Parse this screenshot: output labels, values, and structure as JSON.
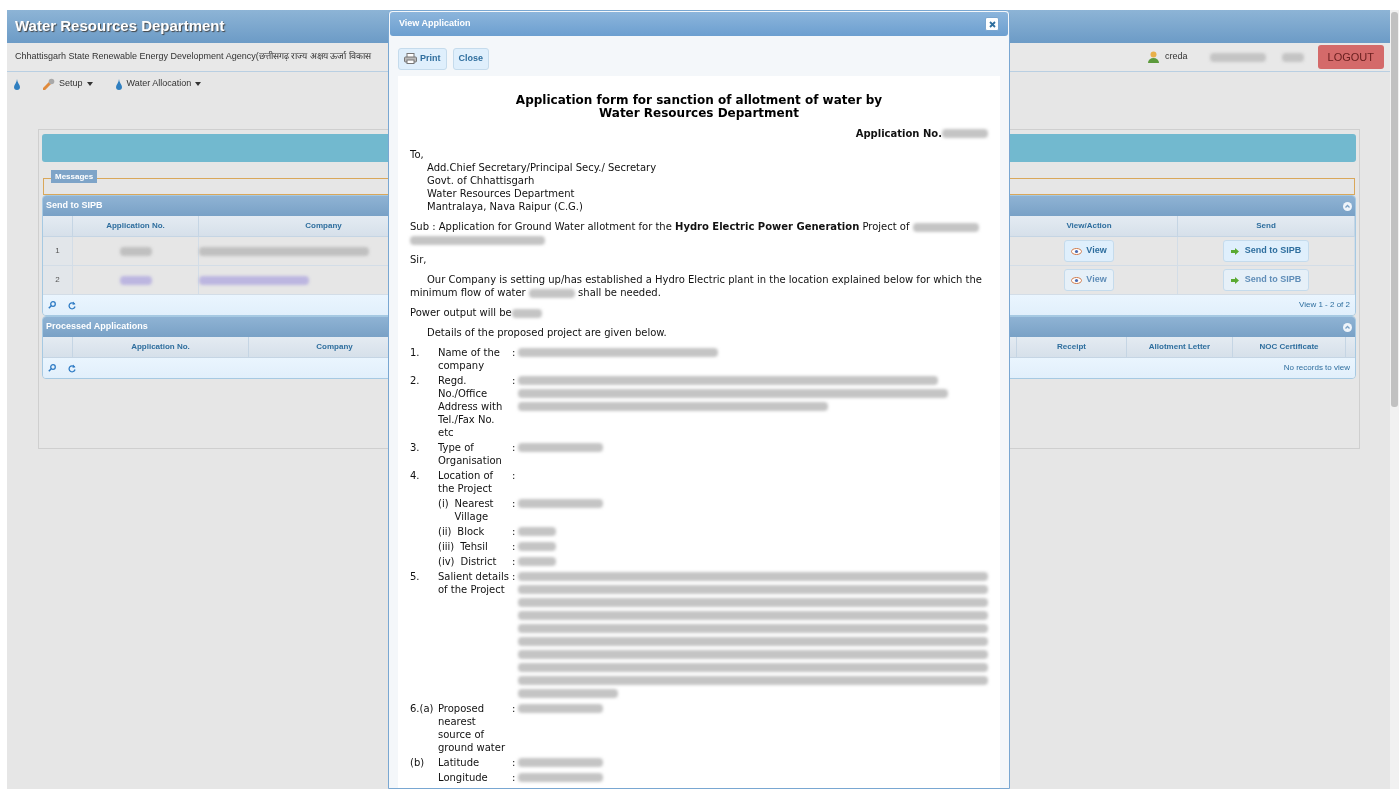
{
  "header": {
    "title": "Water Resources Department",
    "agency": "Chhattisgarh State Renewable Energy Development Agency(छत्तीसगढ़ राज्य अक्षय ऊर्जा विकास",
    "user": "creda",
    "logout": "LOGOUT"
  },
  "menu": [
    {
      "kind": "icon"
    },
    {
      "kind": "menu",
      "label": "Setup"
    },
    {
      "kind": "menu",
      "label": "Water Allocation"
    }
  ],
  "messages": {
    "legend": "Messages"
  },
  "send_grid": {
    "caption": "Send to SIPB",
    "columns": [
      "Application No.",
      "Company",
      "View/Action",
      "Send"
    ],
    "rows": [
      {
        "number": "1",
        "linked": false,
        "disabled": false,
        "view": "View",
        "send": "Send to SIPB"
      },
      {
        "number": "2",
        "linked": true,
        "disabled": true,
        "view": "View",
        "send": "Send to SIPB"
      }
    ],
    "footer": "View 1 - 2 of 2"
  },
  "processed_grid": {
    "caption": "Processed Applications",
    "columns": [
      "Application No.",
      "Company",
      "Receipt",
      "Allotment Letter",
      "NOC Certificate"
    ],
    "footer": "No records to view"
  },
  "dialog": {
    "title": "View Application",
    "buttons": [
      {
        "label": "Print"
      },
      {
        "label": "Close"
      }
    ],
    "form": {
      "title": [
        "Application form for sanction of allotment of water by",
        "Water Resources Department"
      ],
      "application_no": "Application No.",
      "to": "To,",
      "address": [
        "Add.Chief Secretary/Principal Secy./ Secretary",
        "Govt. of Chhattisgarh",
        "Water Resources Department",
        "Mantralaya, Nava Raipur (C.G.)"
      ],
      "subject": "Sub : Application for Ground Water allotment for the **Hydro Electric Power Generation** Project of",
      "salutation": "Sir,",
      "body": "Our Company is setting up/has established a Hydro Electric plant in the location explained below for which the minimum flow of water",
      "body_end": "shall be needed.",
      "power": "Power output will be",
      "intro": "Details of the proposed project are given below.",
      "items": [
        {
          "number": "1.",
          "label": "Name of the company",
          "colon": ":",
          "kind": "line"
        },
        {
          "number": "2.",
          "label": "Regd. No./Office Address with Tel./Fax No. etc",
          "colon": ":",
          "kind": "block"
        },
        {
          "number": "3.",
          "label": "Type of Organisation",
          "colon": ":",
          "kind": "short"
        },
        {
          "number": "4.",
          "label": "Location of the Project",
          "colon": ":",
          "children": [
            {
              "marker": "(i)",
              "label": "Nearest Village",
              "colon": ":",
              "kind": "short"
            },
            {
              "marker": "(ii)",
              "label": "Block",
              "colon": ":",
              "kind": "tiny"
            },
            {
              "marker": "(iii)",
              "label": "Tehsil",
              "colon": ":",
              "kind": "tiny"
            },
            {
              "marker": "(iv)",
              "label": "District",
              "colon": ":",
              "kind": "tiny"
            }
          ]
        },
        {
          "number": "5.",
          "label": "Salient details of the Project",
          "colon": ":",
          "kind": "paragraph"
        },
        {
          "number": "6.(a)",
          "label": "Proposed nearest source of ground water",
          "colon": ":",
          "kind": "short"
        },
        {
          "number": "(b)",
          "label": "Latitude",
          "colon": ":",
          "kind": "short"
        },
        {
          "label": "Longitude",
          "colon": ":",
          "kind": "short"
        }
      ]
    }
  }
}
